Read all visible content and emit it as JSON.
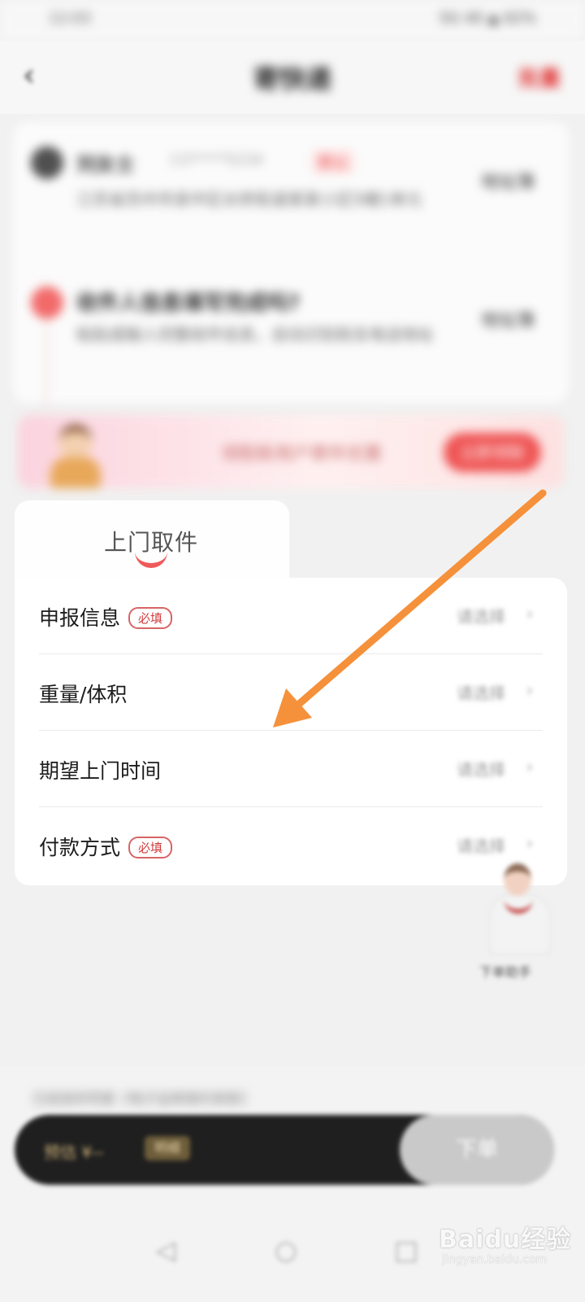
{
  "status_bar": {
    "time": "12:03",
    "icons": "5G 40 ▲ 62%"
  },
  "header": {
    "back_symbol": "‹",
    "title": "寄快递",
    "right_action": "批量"
  },
  "sender": {
    "name": "刘女士",
    "phone": "137****5234",
    "tag": "默认",
    "address": "江苏省苏州市吴中区长桥街道某某小区5幢1单元",
    "action": "地址簿"
  },
  "receiver": {
    "name": "收件人信息填写完成吗?",
    "address": "粘贴或输入完整收件信息，自动识别姓名电话地址",
    "action": "地址簿"
  },
  "banner": {
    "text": "领取新用户寄件优惠",
    "button": "立即领取"
  },
  "tab": {
    "label": "上门取件"
  },
  "form": {
    "required_tag": "必填",
    "rows": [
      {
        "label": "申报信息",
        "required": true,
        "value": "请选择"
      },
      {
        "label": "重量/体积",
        "required": false,
        "value": "请选择"
      },
      {
        "label": "期望上门时间",
        "required": false,
        "value": "请选择"
      },
      {
        "label": "付款方式",
        "required": true,
        "value": "请选择"
      }
    ],
    "chevron": "›"
  },
  "assistant": {
    "label": "下单助手"
  },
  "bottom": {
    "note": "已阅读并同意《电子运单契约条款》",
    "price": "预估 ¥--",
    "price_tag": "明细",
    "submit": "下单"
  },
  "nav": {
    "back": "◁",
    "home": "○",
    "recent": "□"
  },
  "watermark": {
    "main": "Baidu经验",
    "sub": "jingyan.baidu.com"
  },
  "colors": {
    "accent_red": "#ef5454",
    "annotation_arrow": "#f5913a",
    "dark_bar": "#1f1f1f"
  }
}
